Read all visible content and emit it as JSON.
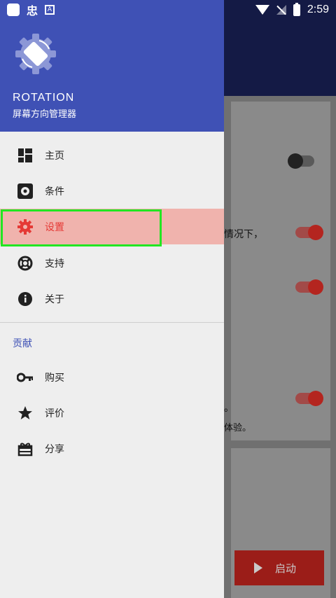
{
  "status_bar": {
    "carrier_glyph": "忠",
    "time": "2:59"
  },
  "drawer": {
    "app_name": "ROTATION",
    "app_subtitle": "屏幕方向管理器",
    "nav_items": [
      {
        "label": "主页",
        "icon": "dashboard-icon"
      },
      {
        "label": "条件",
        "icon": "conditions-gear-icon"
      },
      {
        "label": "设置",
        "icon": "settings-gear-icon",
        "active": true
      },
      {
        "label": "支持",
        "icon": "lifebuoy-icon"
      },
      {
        "label": "关于",
        "icon": "info-icon"
      }
    ],
    "section_title": "贡献",
    "contrib_items": [
      {
        "label": "购买",
        "icon": "key-icon"
      },
      {
        "label": "评价",
        "icon": "star-icon"
      },
      {
        "label": "分享",
        "icon": "gift-icon"
      }
    ]
  },
  "background": {
    "text_1": "情况下，",
    "text_2": "。",
    "text_3": "体验。",
    "switches": [
      false,
      true,
      true,
      true
    ],
    "start_button": "启动"
  },
  "colors": {
    "header": "#3f51b5",
    "active": "#e53935",
    "active_bg": "#f0b3ad",
    "focus": "#22e622"
  }
}
